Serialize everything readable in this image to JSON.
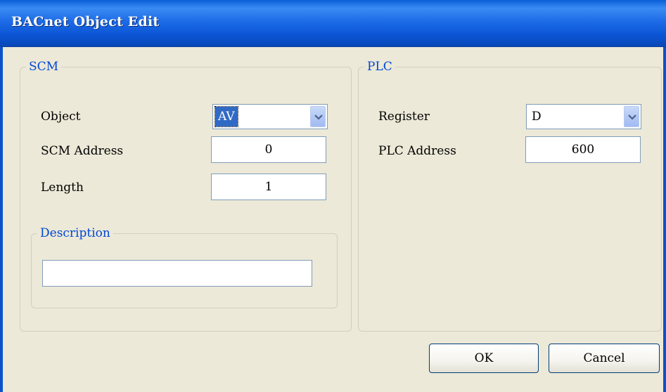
{
  "window": {
    "title": "BACnet Object Edit"
  },
  "scm": {
    "legend": "SCM",
    "object_label": "Object",
    "object_value": "AV",
    "address_label": "SCM Address",
    "address_value": "0",
    "length_label": "Length",
    "length_value": "1",
    "description": {
      "legend": "Description",
      "value": ""
    }
  },
  "plc": {
    "legend": "PLC",
    "register_label": "Register",
    "register_value": "D",
    "address_label": "PLC Address",
    "address_value": "600"
  },
  "buttons": {
    "ok": "OK",
    "cancel": "Cancel"
  }
}
